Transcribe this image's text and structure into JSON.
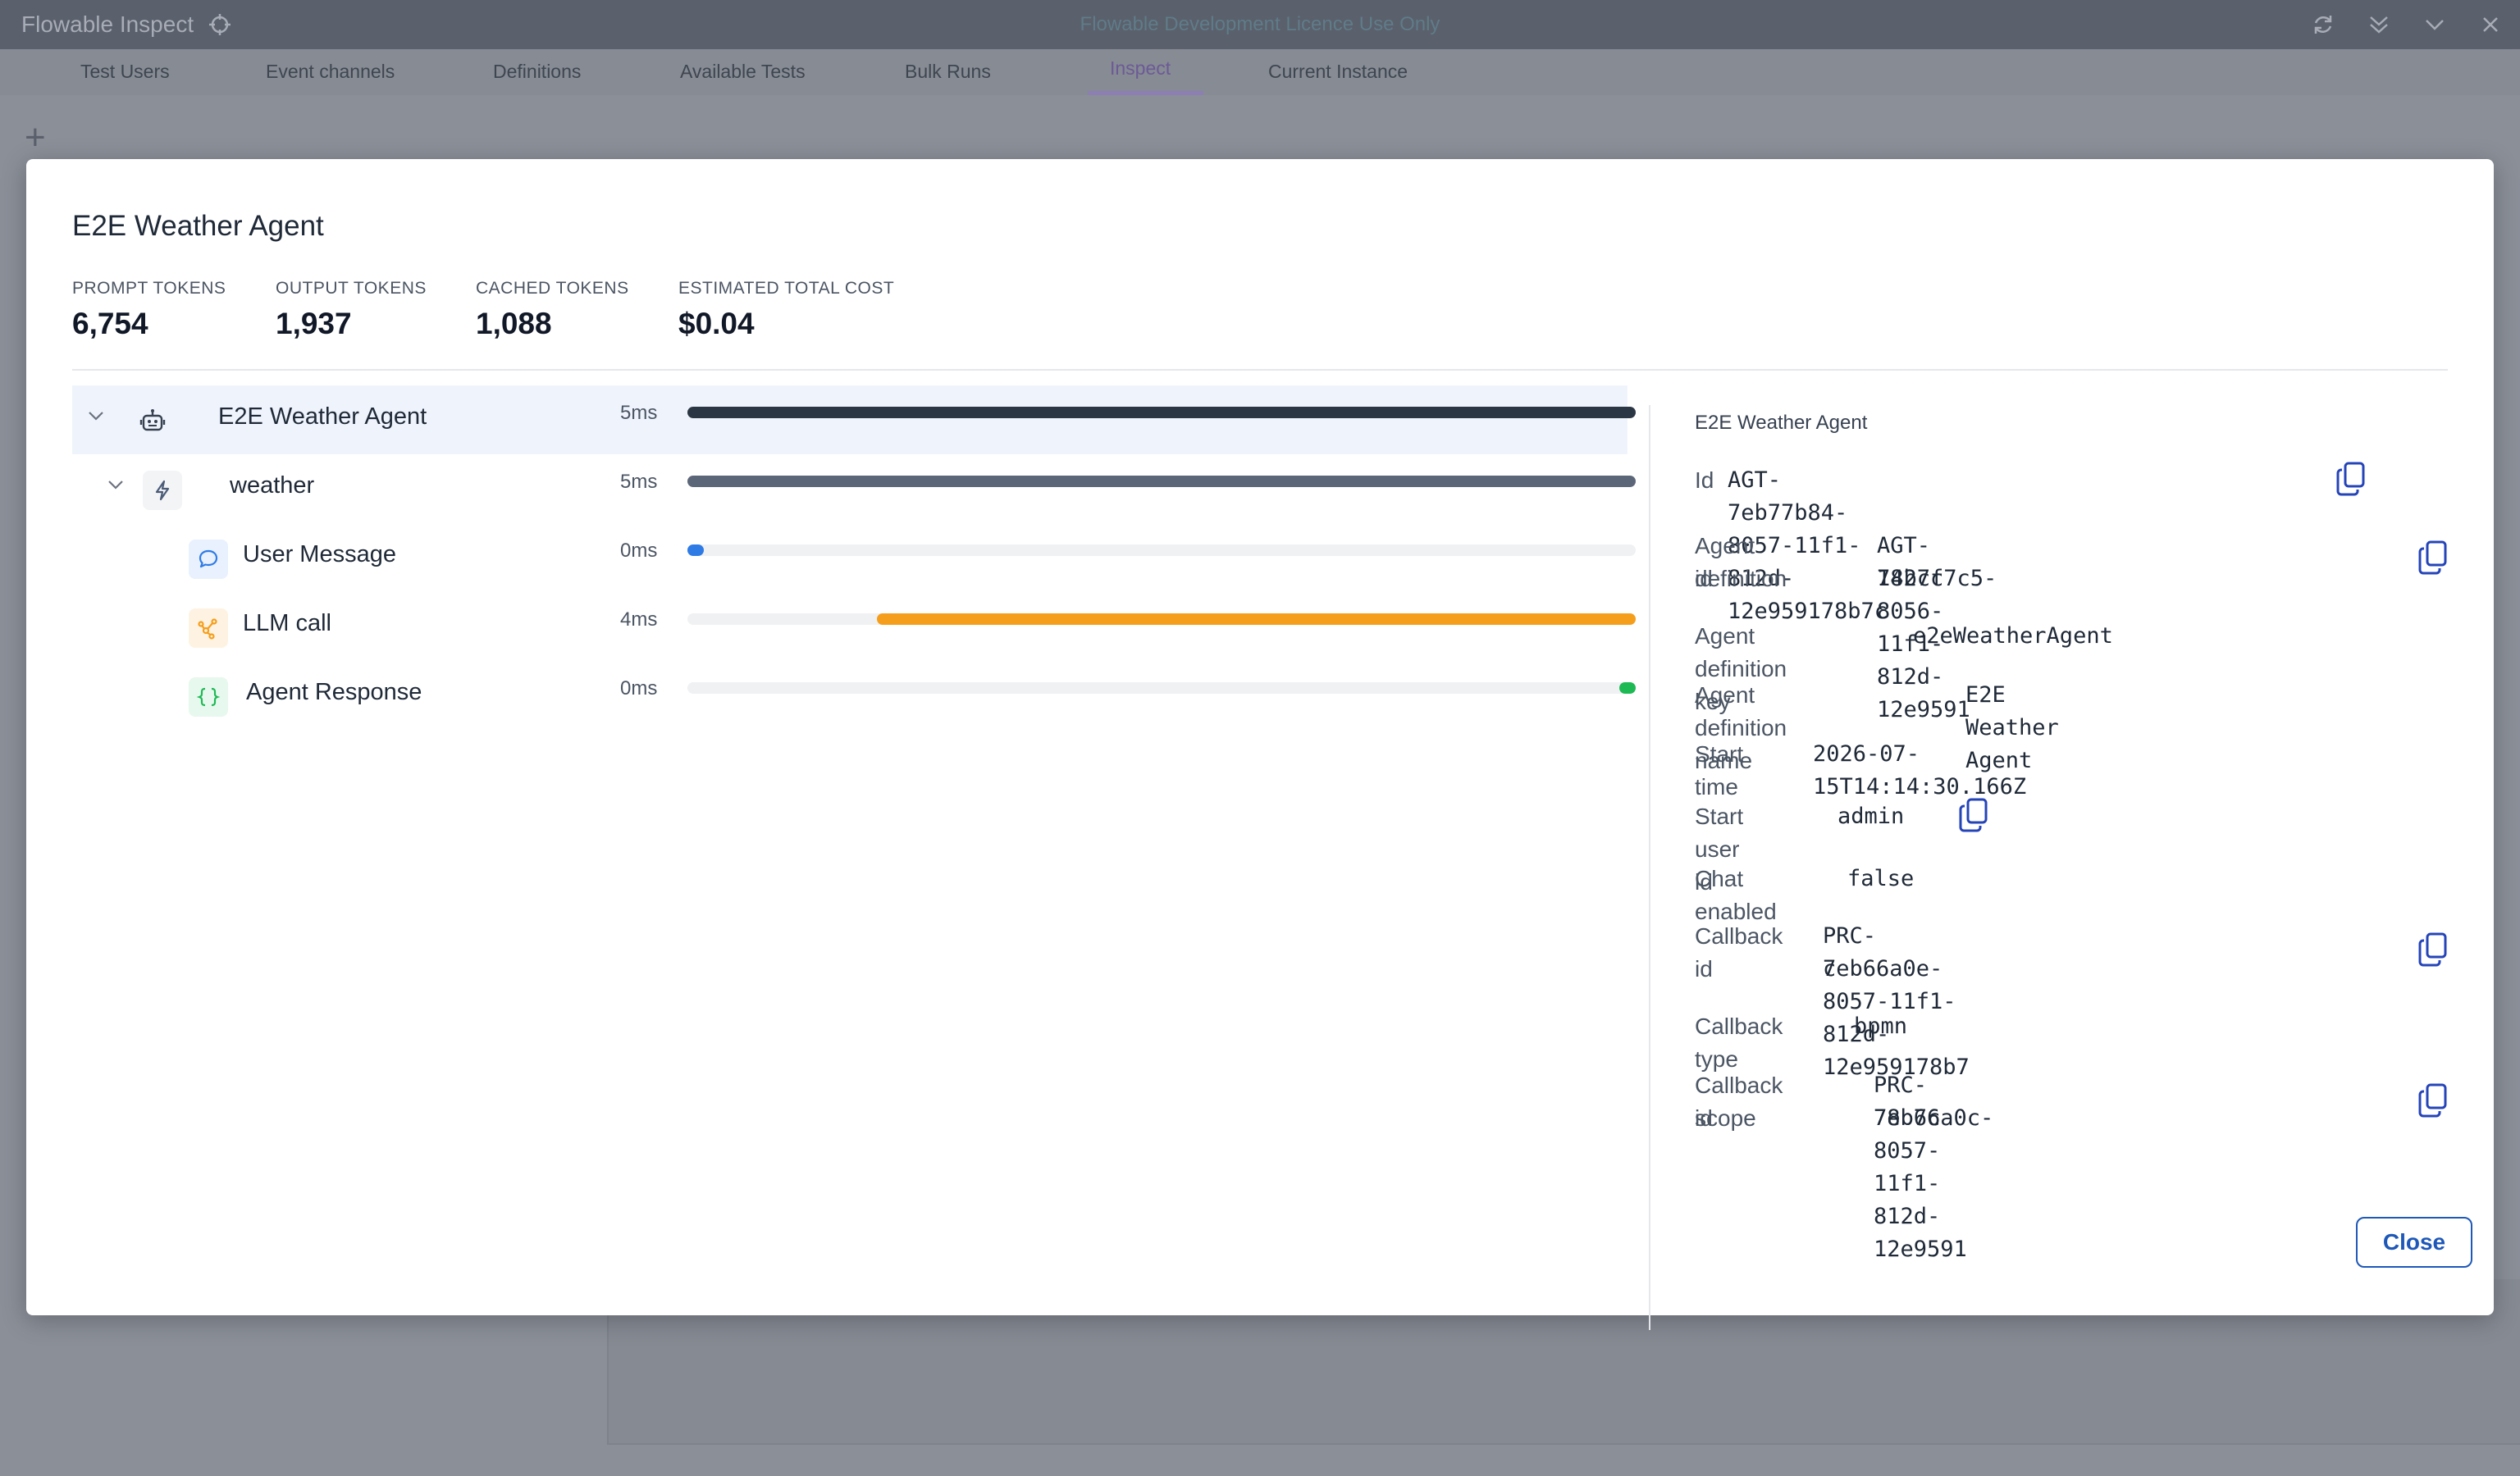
{
  "app": {
    "title": "Flowable Inspect",
    "licence_notice": "Flowable Development Licence Use Only",
    "tabs": [
      "Test Users",
      "Event channels",
      "Definitions",
      "Available Tests",
      "Bulk Runs",
      "Inspect",
      "Current Instance"
    ],
    "active_tab": "Inspect",
    "add_label": "+"
  },
  "modal": {
    "title": "E2E Weather Agent",
    "stats": [
      {
        "label": "PROMPT TOKENS",
        "value": "6,754"
      },
      {
        "label": "OUTPUT TOKENS",
        "value": "1,937"
      },
      {
        "label": "CACHED TOKENS",
        "value": "1,088"
      },
      {
        "label": "ESTIMATED TOTAL COST",
        "value": "$0.04"
      }
    ],
    "trace": [
      {
        "label": "E2E Weather Agent",
        "duration": "5ms",
        "start": 0.0,
        "end": 1.0,
        "color": "#2b3644",
        "icon": "robot-icon"
      },
      {
        "label": "weather",
        "duration": "5ms",
        "start": 0.0,
        "end": 1.0,
        "color": "#5b6678",
        "icon": "lightning-icon"
      },
      {
        "label": "User Message",
        "duration": "0ms",
        "start": 0.0,
        "end": 0.0,
        "color": "#2f7be6",
        "icon": "chat-bubble-icon"
      },
      {
        "label": "LLM call",
        "duration": "4ms",
        "start": 0.2,
        "end": 1.0,
        "color": "#f59e1b",
        "icon": "network-icon"
      },
      {
        "label": "Agent Response",
        "duration": "0ms",
        "start": 1.0,
        "end": 1.0,
        "color": "#1db954",
        "icon": "braces-icon"
      }
    ],
    "details": {
      "title": "E2E Weather Agent",
      "fields": [
        {
          "key": "Id",
          "value": "AGT-7eb77b84-8057-11f1-812d-12e959178b7c"
        },
        {
          "key_l1": "Agent definition",
          "key_l2": "id",
          "value_l1": "AGT-142cf7c5-8056-11f1-812d-12e9591",
          "value_l2": "78b7c"
        },
        {
          "key": "Agent definition key",
          "value": "e2eWeatherAgent"
        },
        {
          "key": "Agent definition name",
          "value": "E2E Weather Agent"
        },
        {
          "key": "Start time",
          "value": "2026-07-15T14:14:30.166Z"
        },
        {
          "key": "Start user id",
          "value": "admin"
        },
        {
          "key": "Chat enabled",
          "value": "false"
        },
        {
          "key_l1": "Callback",
          "key_l2": "id",
          "value_l1": "PRC-7eb66a0e-8057-11f1-812d-12e959178b7",
          "value_l2": "c"
        },
        {
          "key": "Callback type",
          "value": "bpmn"
        },
        {
          "key_l1": "Callback scope",
          "key_l2": "id",
          "value_l1": "PRC-7eb66a0c-8057-11f1-812d-12e9591",
          "value_l2": "78b7c"
        }
      ]
    },
    "close_label": "Close"
  }
}
